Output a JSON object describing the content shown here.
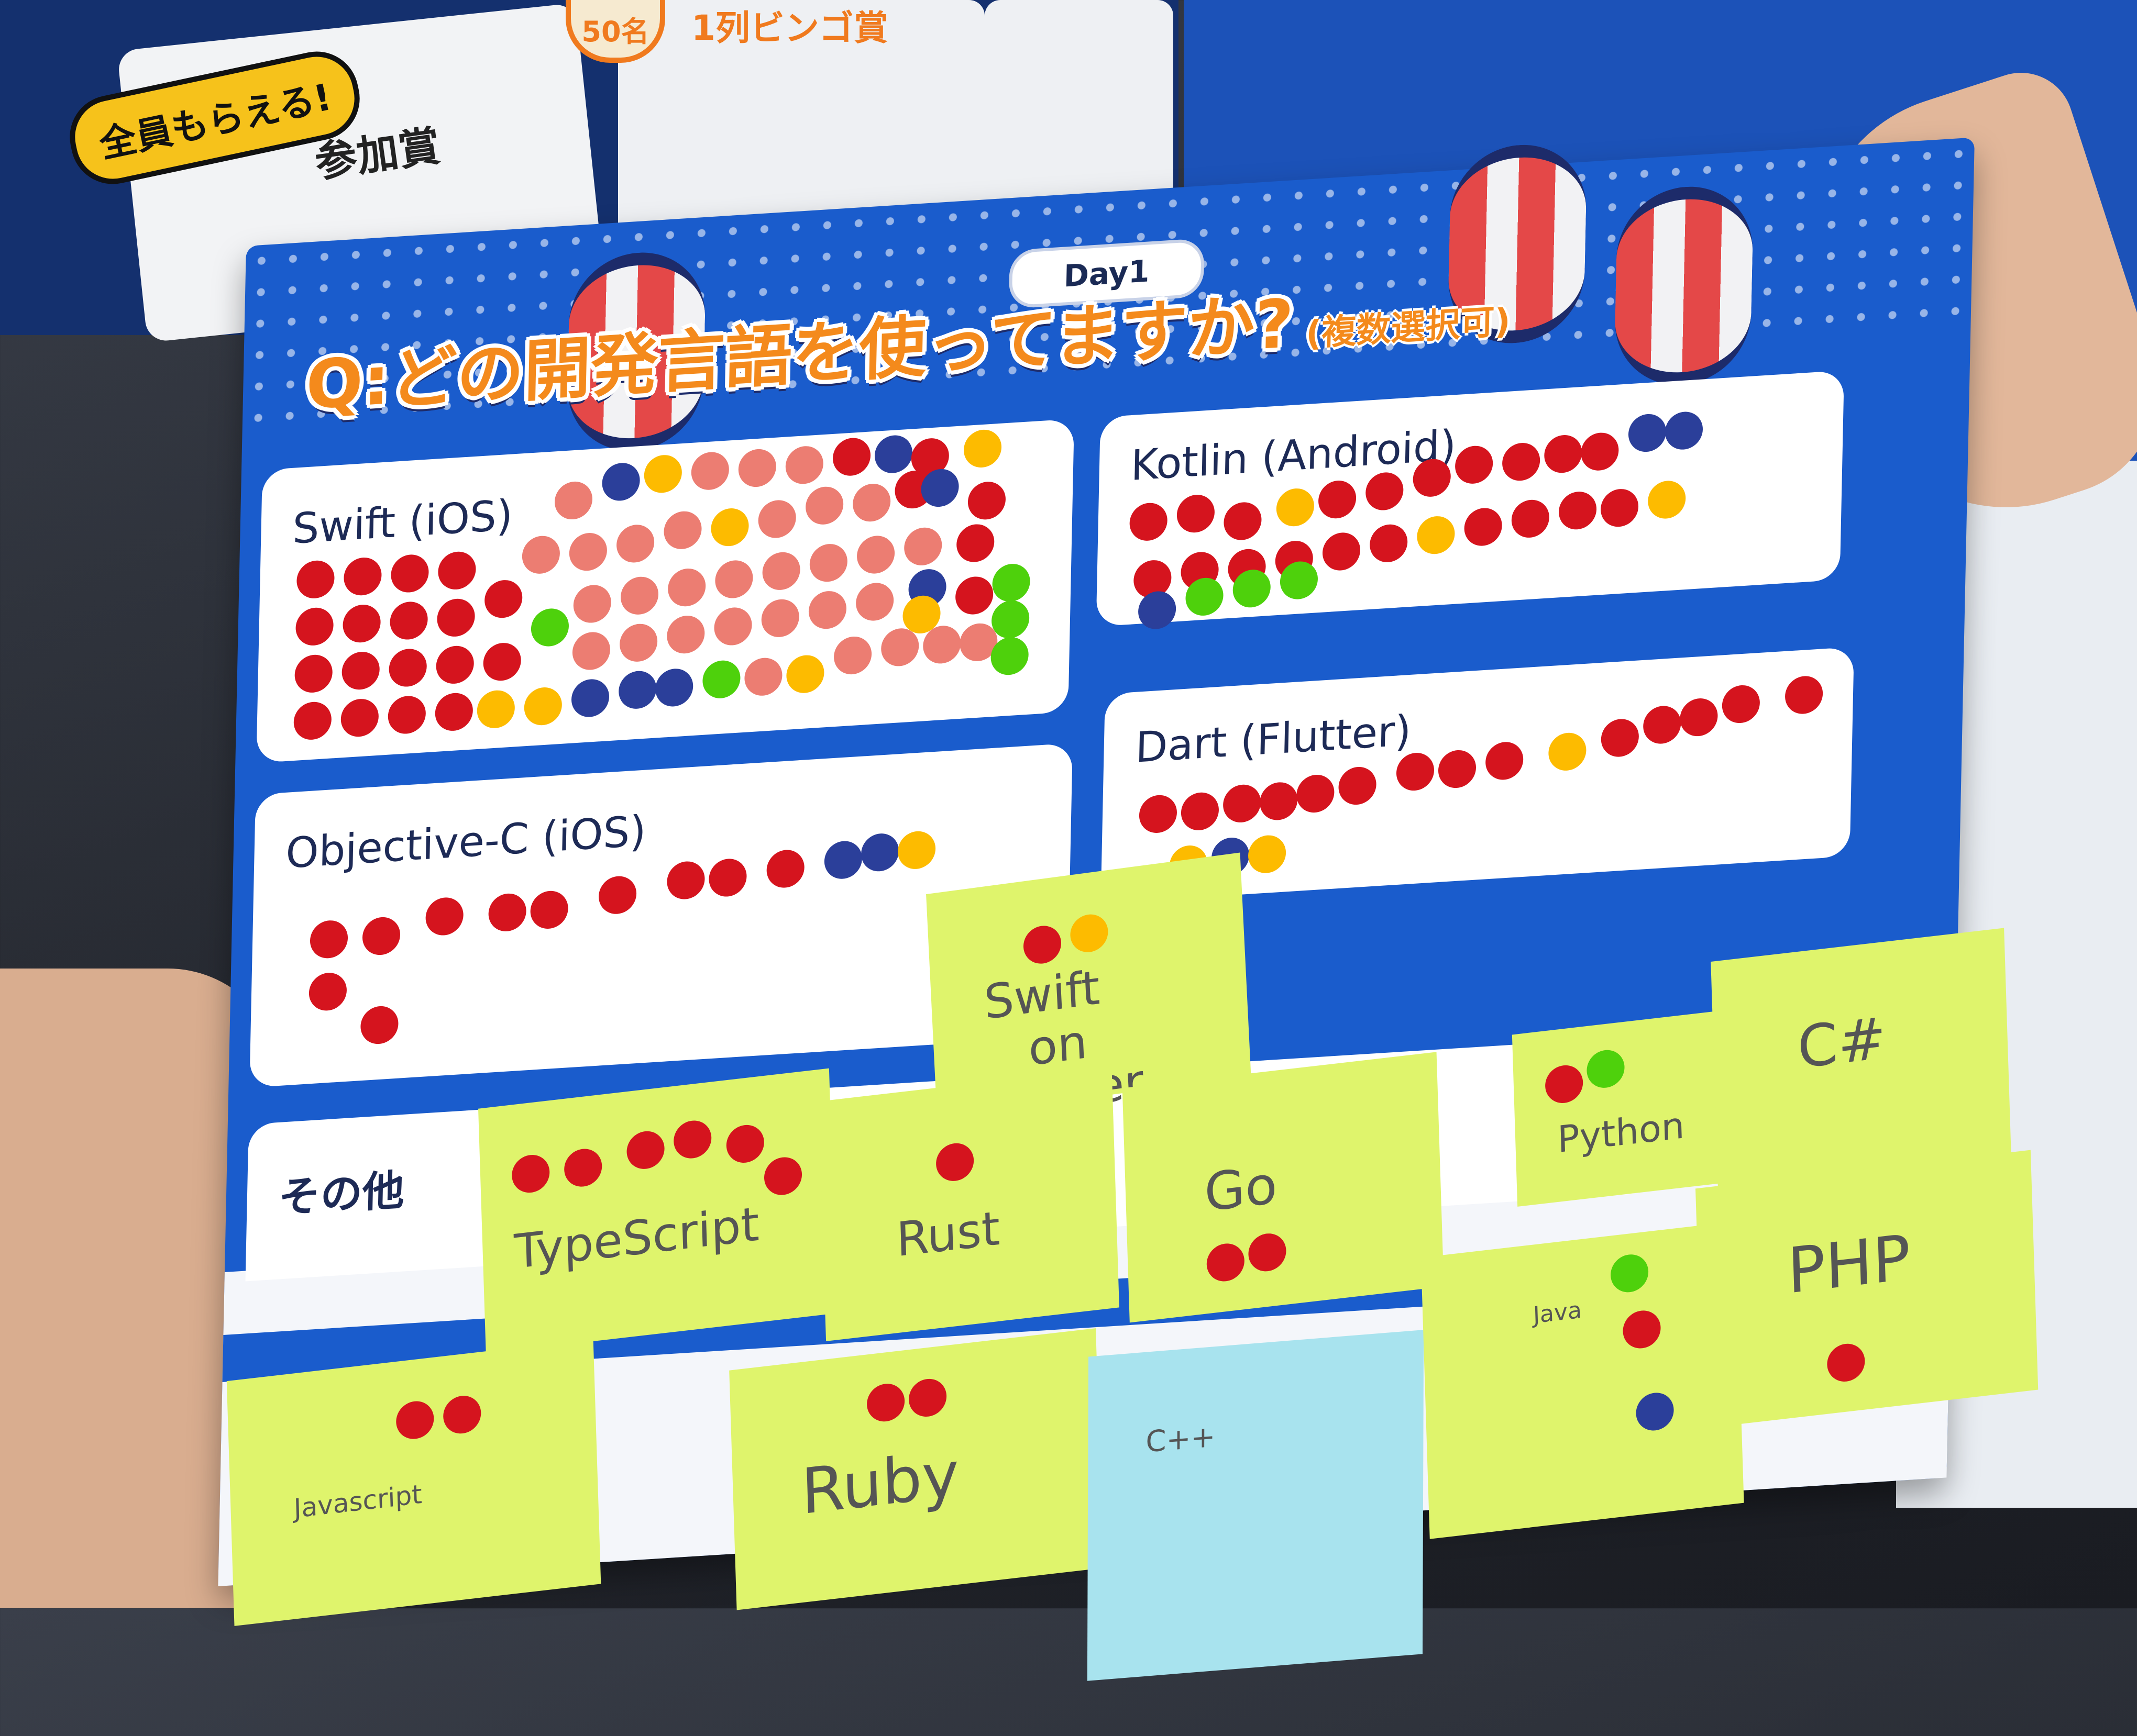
{
  "booth": {
    "pill_text": "全員もらえる!",
    "award_text": "参加賞",
    "badge_text": "50名",
    "bingo_text": "1列ビンゴ賞"
  },
  "board": {
    "day_label": "Day1",
    "question": "Q:どの開発言語を使ってますか?",
    "question_note": "(複数選択可)",
    "panels": {
      "swift": "Swift (iOS)",
      "kotlin": "Kotlin (Android)",
      "objc": "Objective-C (iOS)",
      "dart": "Dart (Flutter)",
      "other": "その他"
    },
    "notes": {
      "swift_server": [
        "Swift",
        "on",
        "Server"
      ],
      "typescript": "TypeScript",
      "rust": "Rust",
      "go": "Go",
      "python": "Python",
      "csharp": "C#",
      "php": "PHP",
      "javascript": "Javascript",
      "ruby": "Ruby",
      "cpp": "C++",
      "java": "Java"
    }
  },
  "colors": {
    "board_blue": "#1a5ccc",
    "title_orange": "#f48a1c",
    "sticker_red": "#d5141e",
    "sticker_pink": "#ec7d72",
    "sticker_blue": "#2b3f9a",
    "sticker_yellow": "#fdbb00",
    "sticker_green": "#4ed10c",
    "note_green": "#dff46c",
    "note_cyan": "#a8e3ee"
  }
}
